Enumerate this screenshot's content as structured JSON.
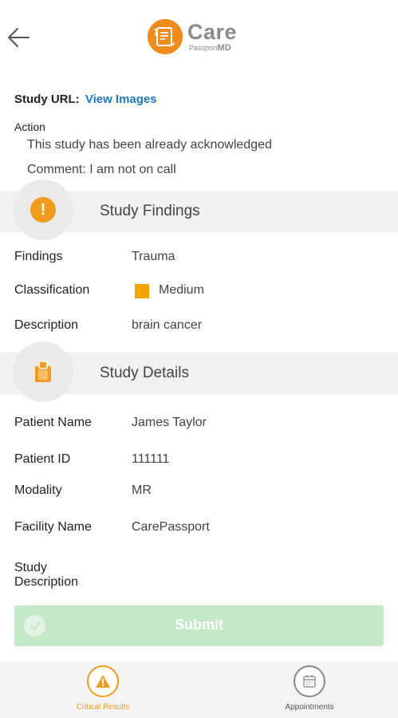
{
  "header": {
    "logo_care": "Care",
    "logo_passport": "Passport",
    "logo_md": "MD"
  },
  "study": {
    "url_label": "Study URL:",
    "url_link": "View Images",
    "action_label": "Action",
    "action_text": "This study has been already acknowledged",
    "comment_text": "Comment: I am not on call"
  },
  "findings_section": {
    "title": "Study Findings",
    "rows": [
      {
        "label": "Findings",
        "value": "Trauma"
      },
      {
        "label": "Classification",
        "value": "Medium"
      },
      {
        "label": "Description",
        "value": "brain cancer"
      }
    ],
    "classification_color": "#f4a300"
  },
  "details_section": {
    "title": "Study Details",
    "rows": [
      {
        "label": "Patient Name",
        "value": "James Taylor"
      },
      {
        "label": "Patient ID",
        "value": "111111"
      },
      {
        "label": "Modality",
        "value": "MR"
      },
      {
        "label": "Facility Name",
        "value": "CarePassport"
      }
    ],
    "study_description_label_line1": "Study",
    "study_description_label_line2": "Description"
  },
  "submit": {
    "label": "Submit",
    "color": "#c5e8c7"
  },
  "bottom_nav": {
    "items": [
      {
        "label": "Critical Results",
        "icon": "warning-icon",
        "active": true,
        "color": "#f19c1a"
      },
      {
        "label": "Appointments",
        "icon": "calendar-icon",
        "active": false,
        "color": "#555555"
      }
    ]
  },
  "accent_color": "#f19c1a",
  "link_color": "#1f78c4"
}
